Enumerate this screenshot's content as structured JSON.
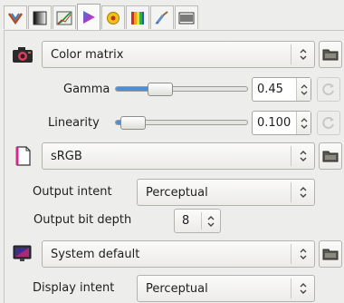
{
  "tabs": [
    {
      "icon": "transform-icon"
    },
    {
      "icon": "levels-icon"
    },
    {
      "icon": "curves-icon"
    },
    {
      "icon": "color-play-icon",
      "active": true
    },
    {
      "icon": "wb-icon"
    },
    {
      "icon": "rainbow-icon"
    },
    {
      "icon": "brush-icon"
    },
    {
      "icon": "metadata-icon"
    }
  ],
  "input_profile": {
    "value": "Color matrix",
    "icon": "camera-icon"
  },
  "gamma": {
    "label": "Gamma",
    "value": "0.45",
    "level": 0.3
  },
  "linearity": {
    "label": "Linearity",
    "value": "0.100",
    "level": 0.05
  },
  "output_profile": {
    "value": "sRGB",
    "icon": "output-profile-icon"
  },
  "output_intent": {
    "label": "Output intent",
    "value": "Perceptual"
  },
  "output_bit_depth": {
    "label": "Output bit depth",
    "value": "8"
  },
  "display_profile": {
    "value": "System default",
    "icon": "monitor-icon"
  },
  "display_intent": {
    "label": "Display intent",
    "value": "Perceptual"
  },
  "colors": {
    "accent": "#4c8ed8",
    "background": "#ededeb"
  }
}
